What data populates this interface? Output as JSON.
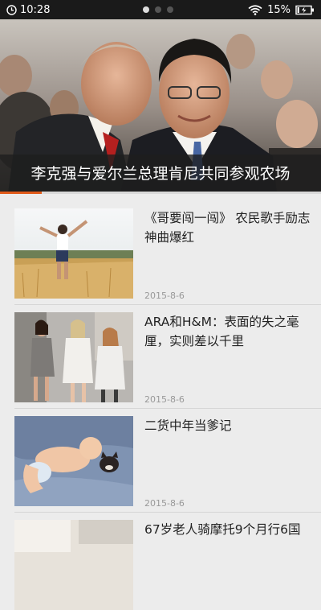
{
  "status_bar": {
    "time": "10:28",
    "battery": "15%",
    "page_dots": 3,
    "active_dot": 0
  },
  "hero": {
    "caption": "李克强与爱尔兰总理肯尼共同参观农场",
    "progress": 0.13
  },
  "articles": [
    {
      "title": "《哥要闯一闯》 农民歌手励志神曲爆红",
      "date": "2015-8-6",
      "thumb": "man-in-wheat-field"
    },
    {
      "title": "ARA和H&M：表面的失之毫厘，实则差以千里",
      "date": "2015-8-6",
      "thumb": "fashion-models"
    },
    {
      "title": "二货中年当爹记",
      "date": "2015-8-6",
      "thumb": "baby-with-cat"
    },
    {
      "title": "67岁老人骑摩托9个月行6国",
      "date": "",
      "thumb": "motorcycle"
    }
  ],
  "colors": {
    "accent": "#e05a1a",
    "background": "#ececec",
    "status_bar": "#1a1a1a"
  }
}
